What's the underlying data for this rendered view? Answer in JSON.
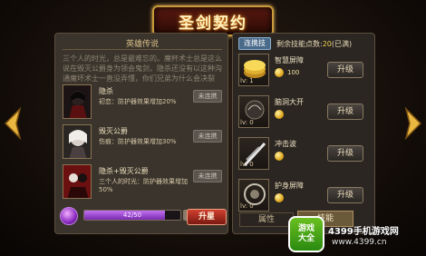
{
  "title": "圣剑契约",
  "legend": {
    "header": "英雄传说",
    "text": "三个人的时光，总是最难忘的。魔杯术士总是这么说在毁灭公爵身为领会鬼剑，隐杀还没有以这种沟通魔坏术士一直没弄懂，你们兄弟为什么会决裂"
  },
  "heroes": [
    {
      "name": "隐杀",
      "desc": "初恋：防护器效果增加20%",
      "button": "未连携"
    },
    {
      "name": "毁灭公爵",
      "desc": "伤痕：防护器效果增加30%",
      "button": "未连携"
    },
    {
      "name": "隐杀+毁灭公爵",
      "desc": "三个人的时光：防护器效果增加50%",
      "button": "未连携"
    }
  ],
  "skills_header": {
    "tag": "连携技",
    "points_label": "剩余技能点数:",
    "points_value": "20",
    "points_suffix": "(已满)"
  },
  "skills": [
    {
      "name": "智慧屏障",
      "level": "lv: 1",
      "cost": "100",
      "button": "升级"
    },
    {
      "name": "脑洞大开",
      "level": "lv: 0",
      "cost": "",
      "button": "升级"
    },
    {
      "name": "冲击波",
      "level": "lv: 0",
      "cost": "",
      "button": "升级"
    },
    {
      "name": "护身屏障",
      "level": "lv: 0",
      "cost": "",
      "button": "升级"
    }
  ],
  "bottom": {
    "xp_text": "42/50",
    "xp_fraction": 0.84,
    "star_button": "升星",
    "tab_attributes": "属性",
    "tab_skills": "技能"
  },
  "watermark": {
    "badge_line1": "游戏",
    "badge_line2": "大全",
    "brand": "4399手机游戏网",
    "url": "www.4399.cn"
  }
}
